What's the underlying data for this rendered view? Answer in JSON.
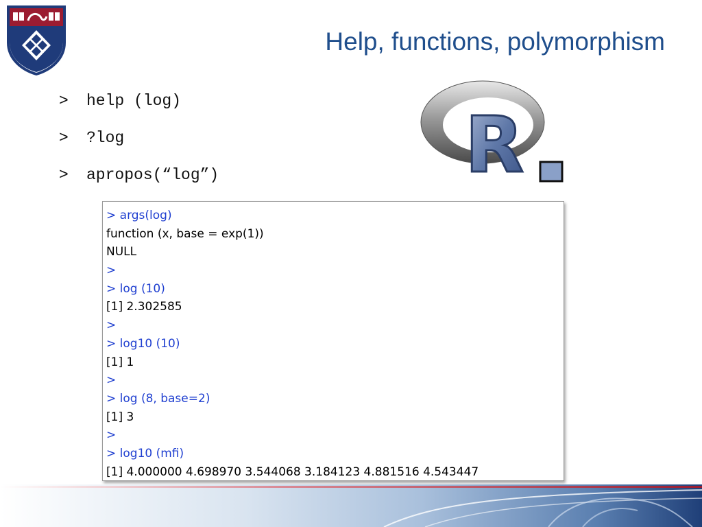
{
  "slide": {
    "title": "Help, functions, polymorphism",
    "bullets": [
      {
        "prompt": ">",
        "text": "help (log)"
      },
      {
        "prompt": ">",
        "text": "?log"
      },
      {
        "prompt": ">",
        "text": "apropos(“log”)"
      }
    ]
  },
  "console": {
    "lines": [
      {
        "prompt": ">",
        "text": " args(log)",
        "kind": "input"
      },
      {
        "prompt": "",
        "text": "function (x, base = exp(1))",
        "kind": "output"
      },
      {
        "prompt": "",
        "text": "NULL",
        "kind": "output"
      },
      {
        "prompt": ">",
        "text": "",
        "kind": "input"
      },
      {
        "prompt": ">",
        "text": " log (10)",
        "kind": "input"
      },
      {
        "prompt": "",
        "text": "[1] 2.302585",
        "kind": "output"
      },
      {
        "prompt": ">",
        "text": "",
        "kind": "input"
      },
      {
        "prompt": ">",
        "text": " log10 (10)",
        "kind": "input"
      },
      {
        "prompt": "",
        "text": "[1] 1",
        "kind": "output"
      },
      {
        "prompt": ">",
        "text": "",
        "kind": "input"
      },
      {
        "prompt": ">",
        "text": " log (8, base=2)",
        "kind": "input"
      },
      {
        "prompt": "",
        "text": "[1] 3",
        "kind": "output"
      },
      {
        "prompt": ">",
        "text": "",
        "kind": "input"
      },
      {
        "prompt": ">",
        "text": " log10 (mfi)",
        "kind": "input"
      },
      {
        "prompt": "",
        "text": "[1] 4.000000 4.698970 3.544068 3.184123 4.881516 4.543447",
        "kind": "output"
      }
    ]
  },
  "logos": {
    "penn_shield_icon": "penn-shield-icon",
    "r_logo_icon": "r-logo-icon",
    "r_logo_text": "R"
  },
  "colors": {
    "title": "#1f4e8c",
    "console_input": "#1f3fd0",
    "shield_red": "#9b1c31",
    "shield_blue": "#1f3b7a"
  }
}
